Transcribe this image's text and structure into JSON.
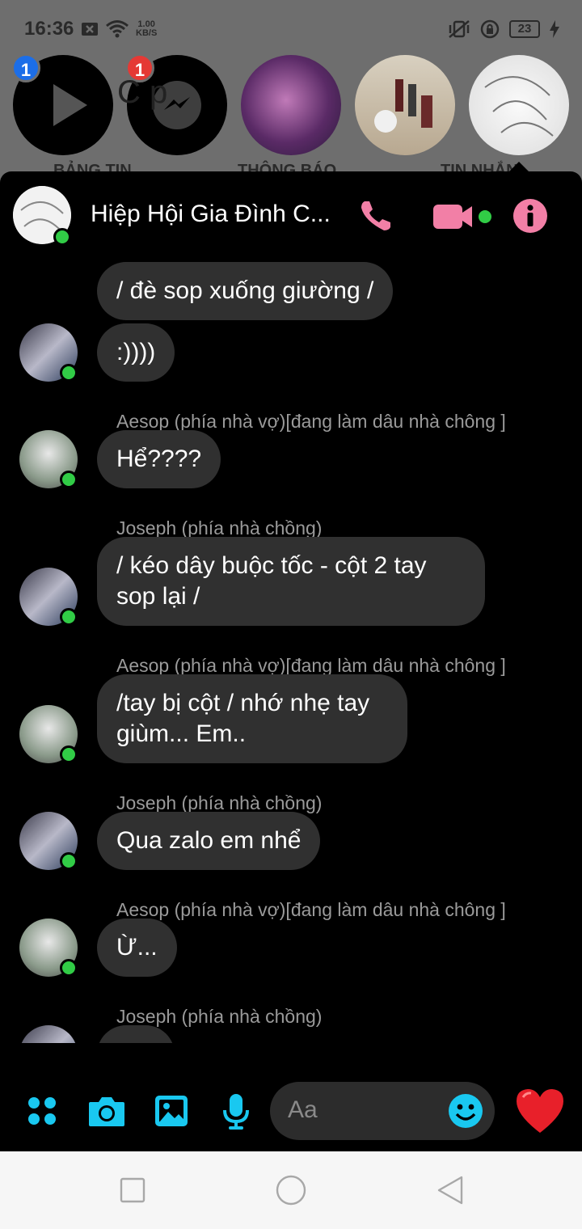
{
  "status_bar": {
    "time": "16:36",
    "net_speed_value": "1.00",
    "net_speed_unit": "KB/S",
    "battery": "23"
  },
  "background": {
    "badge_1": "1",
    "badge_2": "1",
    "label_1": "BẢNG TIN",
    "label_2": "THÔNG BÁO",
    "label_3": "TIN NHẮN",
    "partial_text": "C        p"
  },
  "chat": {
    "title": "Hiệp Hội Gia Đình C...",
    "messages": [
      {
        "text": "/ đè sop xuống giường /"
      },
      {
        "text": ":))))"
      },
      {
        "sender": "Aesop (phía nhà vợ)[đang làm dâu nhà chông ]",
        "text": "Hể????"
      },
      {
        "sender": "Joseph (phía nhà chồng)",
        "text": "/ kéo dây buộc tốc - cột 2 tay sop lại /"
      },
      {
        "sender": "Aesop (phía nhà vợ)[đang làm dâu nhà chông ]",
        "text": "/tay bị cột / nhớ nhẹ tay giùm... Em.."
      },
      {
        "sender": "Joseph (phía nhà chồng)",
        "text": "Qua zalo em nhể"
      },
      {
        "sender": "Aesop (phía nhà vợ)[đang làm dâu nhà chông ]",
        "text": "Ừ..."
      },
      {
        "sender": "Joseph (phía nhà chồng)",
        "text": ":))))"
      }
    ]
  },
  "composer": {
    "placeholder": "Aa"
  },
  "colors": {
    "accent_pink": "#f27fa6",
    "composer_blue": "#19c8f0",
    "online_green": "#31cc46",
    "bubble_gray": "#303030"
  },
  "icons": [
    "grid-icon",
    "camera-icon",
    "image-icon",
    "microphone-icon",
    "emoji-icon",
    "heart-icon",
    "phone-icon",
    "video-icon",
    "info-icon",
    "square-nav-icon",
    "circle-nav-icon",
    "back-triangle-icon"
  ]
}
